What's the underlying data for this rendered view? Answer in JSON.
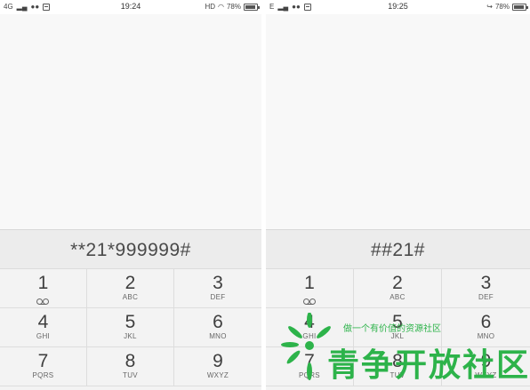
{
  "left_phone": {
    "status": {
      "network": "4G",
      "time": "19:24",
      "hd": "HD",
      "battery": "78%",
      "battery_level": 0.78,
      "icons": [
        "signal-icon",
        "wechat-icon",
        "sim-icon",
        "wifi-icon",
        "battery-icon"
      ]
    },
    "dialed_number": "**21*999999#"
  },
  "right_phone": {
    "status": {
      "network": "E",
      "time": "19:25",
      "battery": "78%",
      "battery_level": 0.78,
      "icons": [
        "signal-icon",
        "wechat-icon",
        "sim-icon",
        "call-forward-icon",
        "battery-icon"
      ]
    },
    "dialed_number": "##21#"
  },
  "keypad": [
    {
      "digit": "1",
      "letters": "",
      "icon": "voicemail-icon"
    },
    {
      "digit": "2",
      "letters": "ABC"
    },
    {
      "digit": "3",
      "letters": "DEF"
    },
    {
      "digit": "4",
      "letters": "GHI"
    },
    {
      "digit": "5",
      "letters": "JKL"
    },
    {
      "digit": "6",
      "letters": "MNO"
    },
    {
      "digit": "7",
      "letters": "PQRS"
    },
    {
      "digit": "8",
      "letters": "TUV"
    },
    {
      "digit": "9",
      "letters": "WXYZ"
    }
  ],
  "watermark": {
    "tagline": "做一个有价值的资源社区",
    "title": "青争开放社区",
    "color": "#2db34a"
  }
}
